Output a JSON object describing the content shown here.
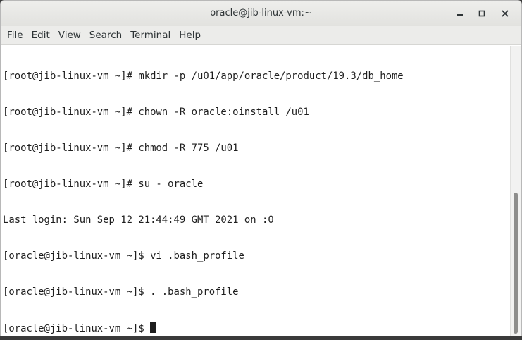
{
  "window": {
    "title": "oracle@jib-linux-vm:~"
  },
  "controls": {
    "minimize_icon": "minimize-icon",
    "maximize_icon": "maximize-icon",
    "close_icon": "close-icon"
  },
  "menu": {
    "items": [
      {
        "label": "File"
      },
      {
        "label": "Edit"
      },
      {
        "label": "View"
      },
      {
        "label": "Search"
      },
      {
        "label": "Terminal"
      },
      {
        "label": "Help"
      }
    ]
  },
  "terminal": {
    "lines": [
      "[root@jib-linux-vm ~]# mkdir -p /u01/app/oracle/product/19.3/db_home",
      "[root@jib-linux-vm ~]# chown -R oracle:oinstall /u01",
      "[root@jib-linux-vm ~]# chmod -R 775 /u01",
      "[root@jib-linux-vm ~]# su - oracle",
      "Last login: Sun Sep 12 21:44:49 GMT 2021 on :0",
      "[oracle@jib-linux-vm ~]$ vi .bash_profile",
      "[oracle@jib-linux-vm ~]$ . .bash_profile"
    ],
    "prompt": "[oracle@jib-linux-vm ~]$ "
  }
}
